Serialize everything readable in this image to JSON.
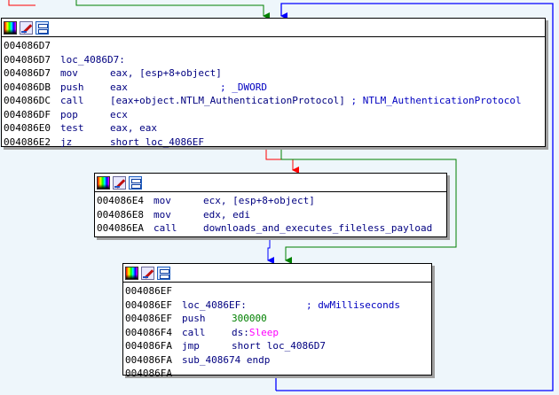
{
  "colors": {
    "background": "#eef6fb",
    "edge_false": "#ff0000",
    "edge_true": "#008000",
    "edge_unconditional": "#0000ff",
    "address": "#000000",
    "code": "#000080",
    "comment": "#0000c0",
    "number": "#008000",
    "api": "#ff00ff"
  },
  "blocks": [
    {
      "icons": [
        "palette-icon",
        "rename-icon",
        "graph-icon"
      ],
      "lines": [
        {
          "addr": "004086D7",
          "mn": "",
          "op": ""
        },
        {
          "addr": "004086D7",
          "mn": "loc_4086D7:",
          "op": ""
        },
        {
          "addr": "004086D7",
          "mn": "mov",
          "op": "eax, [esp+8+object]"
        },
        {
          "addr": "004086DB",
          "mn": "push",
          "op": "eax",
          "cmt": "; _DWORD"
        },
        {
          "addr": "004086DC",
          "mn": "call",
          "op": "[eax+object.NTLM_AuthenticationProtocol]",
          "cmt": "; NTLM_AuthenticationProtocol"
        },
        {
          "addr": "004086DF",
          "mn": "pop",
          "op": "ecx"
        },
        {
          "addr": "004086E0",
          "mn": "test",
          "op": "eax, eax"
        },
        {
          "addr": "004086E2",
          "mn": "jz",
          "op": "short loc_4086EF"
        }
      ]
    },
    {
      "icons": [
        "palette-icon",
        "rename-icon",
        "graph-icon"
      ],
      "lines": [
        {
          "addr": "004086E4",
          "mn": "mov",
          "op": "ecx, [esp+8+object]"
        },
        {
          "addr": "004086E8",
          "mn": "mov",
          "op": "edx, edi"
        },
        {
          "addr": "004086EA",
          "mn": "call",
          "op": "downloads_and_executes_fileless_payload"
        }
      ]
    },
    {
      "icons": [
        "palette-icon",
        "rename-icon",
        "graph-icon"
      ],
      "lines": [
        {
          "addr": "004086EF",
          "mn": "",
          "op": ""
        },
        {
          "addr": "004086EF",
          "mn": "loc_4086EF:",
          "op": "",
          "cmt": "; dwMilliseconds"
        },
        {
          "addr": "004086EF",
          "mn": "push",
          "op": "",
          "num": "300000"
        },
        {
          "addr": "004086F4",
          "mn": "call",
          "op": "ds:",
          "api": "Sleep"
        },
        {
          "addr": "004086FA",
          "mn": "jmp",
          "op": "short loc_4086D7"
        },
        {
          "addr": "004086FA",
          "mn": "sub_408674 endp",
          "op": ""
        },
        {
          "addr": "004086FA",
          "mn": "",
          "op": ""
        }
      ]
    }
  ]
}
